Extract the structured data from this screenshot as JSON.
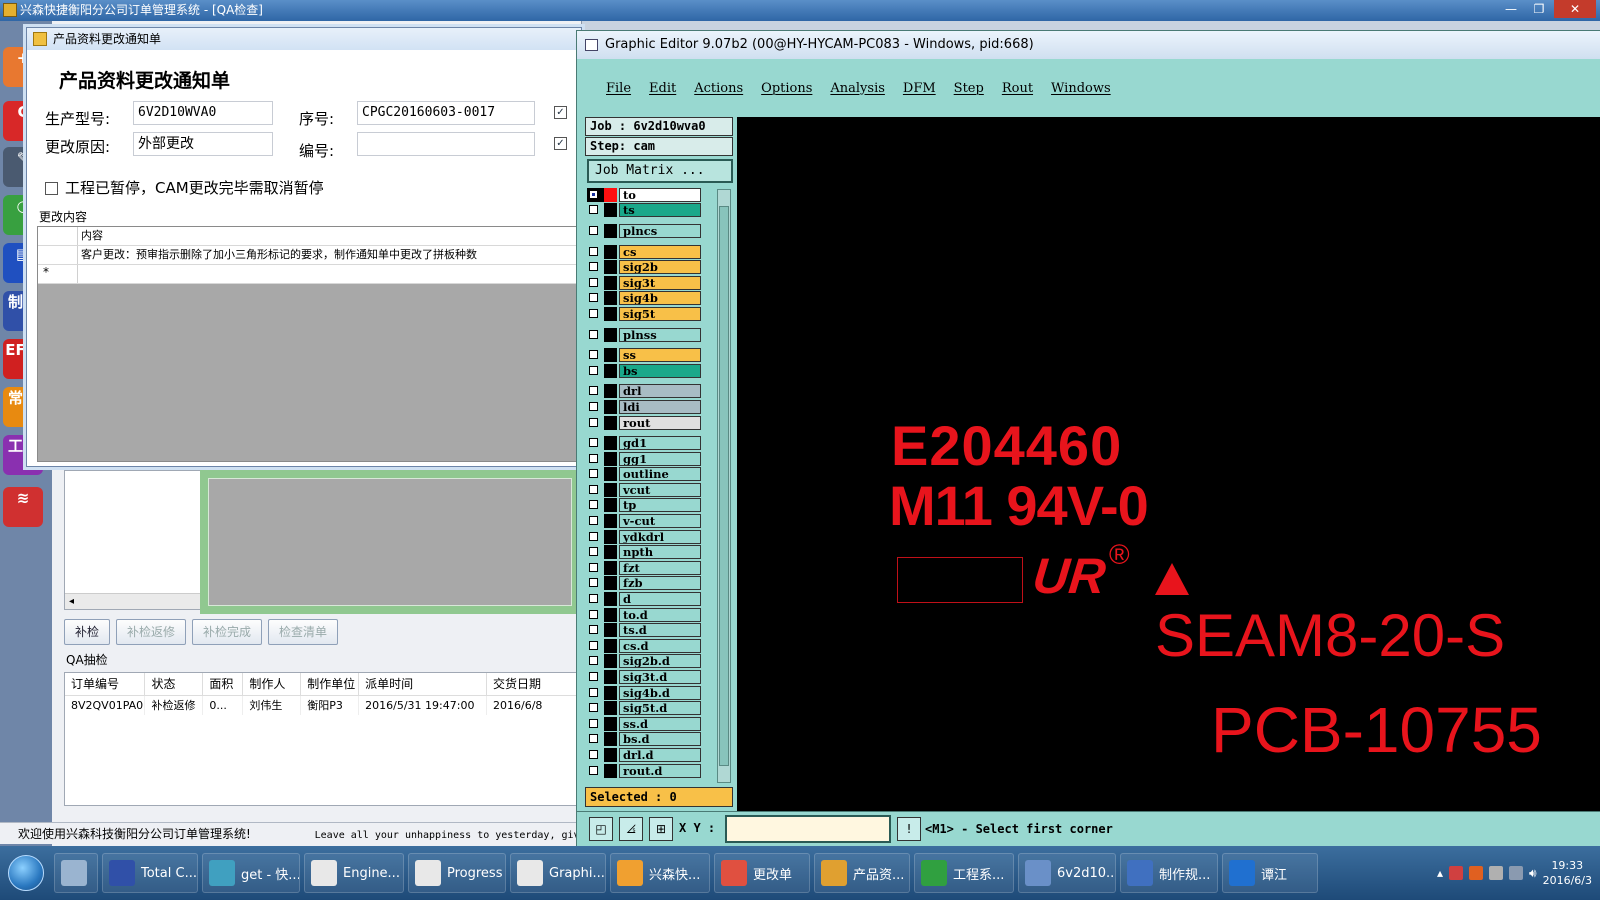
{
  "main_window": {
    "title": "兴森快捷衡阳分公司订单管理系统 - [QA检查]",
    "controls": {
      "minimize": "—",
      "maximize": "❐",
      "close": "✕"
    }
  },
  "launcher": {
    "items": [
      {
        "icon": "orange-plus-icon",
        "label": "+"
      },
      {
        "icon": "red-c-icon",
        "label": "C"
      },
      {
        "icon": "tools-icon",
        "label": "✎"
      },
      {
        "icon": "chart-icon",
        "label": "◔"
      },
      {
        "icon": "doc-icon",
        "label": "▤"
      },
      {
        "icon": "rule-icon",
        "label": "制规"
      },
      {
        "icon": "ef-icon",
        "label": "EF规"
      },
      {
        "icon": "faq-icon",
        "label": "常问"
      },
      {
        "icon": "eng-icon",
        "label": "工能"
      },
      {
        "icon": "db-icon",
        "label": "≋"
      }
    ]
  },
  "dialog": {
    "title": "产品资料更改通知单",
    "heading": "产品资料更改通知单",
    "fields": {
      "model_label": "生产型号:",
      "model_value": "6V2D10WVA0",
      "seq_label": "序号:",
      "seq_value": "CPGC20160603-0017",
      "reason_label": "更改原因:",
      "reason_value": "外部更改",
      "code_label": "编号:",
      "code_value": ""
    },
    "pause_checkbox_label": "工程已暂停，CAM更改完毕需取消暂停",
    "content_section_label": "更改内容",
    "grid": {
      "header": "内容",
      "rows": [
        "客户更改：预审指示删除了加小三角形标记的要求，制作通知单中更改了拼板种数"
      ],
      "new_row_marker": "*"
    }
  },
  "bg_window": {
    "buttons": [
      {
        "label": "补检",
        "enabled": true
      },
      {
        "label": "补检返修",
        "enabled": false
      },
      {
        "label": "补检完成",
        "enabled": false
      },
      {
        "label": "检查清单",
        "enabled": false
      }
    ],
    "qa_section_label": "QA抽检",
    "qa_table": {
      "columns": [
        "订单编号",
        "状态",
        "面积",
        "制作人",
        "制作单位",
        "派单时间",
        "交货日期"
      ],
      "rows": [
        [
          "8V2QV01PA0",
          "补检返修",
          "0...",
          "刘伟生",
          "衡阳P3",
          "2016/5/31 19:47:00",
          "2016/6/8"
        ]
      ]
    },
    "status_welcome": "欢迎使用兴森科技衡阳分公司订单管理系统!",
    "status_scroll": "Leave all your unhappiness to yesterday, giv"
  },
  "graphic_editor": {
    "title": "Graphic Editor 9.07b2 (00@HY-HYCAM-PC083 - Windows, pid:668)",
    "menu": [
      "File",
      "Edit",
      "Actions",
      "Options",
      "Analysis",
      "DFM",
      "Step",
      "Rout",
      "Windows"
    ],
    "job": "Job : 6v2d10wva0",
    "step": "Step: cam",
    "job_matrix": "Job Matrix ...",
    "layers": [
      {
        "name": "to",
        "color": "#ffffff",
        "swatch": "#ff1010",
        "group_end": false,
        "active": true
      },
      {
        "name": "ts",
        "color": "#1aa88a",
        "swatch": "#000000",
        "group_end": true
      },
      {
        "name": "plncs",
        "color": "#98d8d0",
        "swatch": "#000000",
        "group_end": true
      },
      {
        "name": "cs",
        "color": "#f8c048",
        "swatch": "#000000",
        "group_end": false
      },
      {
        "name": "sig2b",
        "color": "#f8c048",
        "swatch": "#000000",
        "group_end": false
      },
      {
        "name": "sig3t",
        "color": "#f8c048",
        "swatch": "#000000",
        "group_end": false
      },
      {
        "name": "sig4b",
        "color": "#f8c048",
        "swatch": "#000000",
        "group_end": false
      },
      {
        "name": "sig5t",
        "color": "#f8c048",
        "swatch": "#000000",
        "group_end": true
      },
      {
        "name": "plnss",
        "color": "#98d8d0",
        "swatch": "#000000",
        "group_end": true
      },
      {
        "name": "ss",
        "color": "#f8c048",
        "swatch": "#000000",
        "group_end": false
      },
      {
        "name": "bs",
        "color": "#1aa88a",
        "swatch": "#000000",
        "group_end": true
      },
      {
        "name": "drl",
        "color": "#a8bcc4",
        "swatch": "#000000",
        "group_end": false
      },
      {
        "name": "ldi",
        "color": "#a8bcc4",
        "swatch": "#000000",
        "group_end": false
      },
      {
        "name": "rout",
        "color": "#e0e0e0",
        "swatch": "#000000",
        "group_end": true
      },
      {
        "name": "gd1",
        "color": "#98d8d0",
        "swatch": "#000000",
        "group_end": false
      },
      {
        "name": "gg1",
        "color": "#98d8d0",
        "swatch": "#000000",
        "group_end": false
      },
      {
        "name": "outline",
        "color": "#98d8d0",
        "swatch": "#000000",
        "group_end": false
      },
      {
        "name": "vcut",
        "color": "#98d8d0",
        "swatch": "#000000",
        "group_end": false
      },
      {
        "name": "tp",
        "color": "#98d8d0",
        "swatch": "#000000",
        "group_end": false
      },
      {
        "name": "v-cut",
        "color": "#98d8d0",
        "swatch": "#000000",
        "group_end": false
      },
      {
        "name": "ydkdrl",
        "color": "#98d8d0",
        "swatch": "#000000",
        "group_end": false
      },
      {
        "name": "npth",
        "color": "#98d8d0",
        "swatch": "#000000",
        "group_end": false
      },
      {
        "name": "fzt",
        "color": "#98d8d0",
        "swatch": "#000000",
        "group_end": false
      },
      {
        "name": "fzb",
        "color": "#98d8d0",
        "swatch": "#000000",
        "group_end": false
      },
      {
        "name": "d",
        "color": "#98d8d0",
        "swatch": "#000000",
        "group_end": false
      },
      {
        "name": "to.d",
        "color": "#98d8d0",
        "swatch": "#000000",
        "group_end": false
      },
      {
        "name": "ts.d",
        "color": "#98d8d0",
        "swatch": "#000000",
        "group_end": false
      },
      {
        "name": "cs.d",
        "color": "#98d8d0",
        "swatch": "#000000",
        "group_end": false
      },
      {
        "name": "sig2b.d",
        "color": "#98d8d0",
        "swatch": "#000000",
        "group_end": false
      },
      {
        "name": "sig3t.d",
        "color": "#98d8d0",
        "swatch": "#000000",
        "group_end": false
      },
      {
        "name": "sig4b.d",
        "color": "#98d8d0",
        "swatch": "#000000",
        "group_end": false
      },
      {
        "name": "sig5t.d",
        "color": "#98d8d0",
        "swatch": "#000000",
        "group_end": false
      },
      {
        "name": "ss.d",
        "color": "#98d8d0",
        "swatch": "#000000",
        "group_end": false
      },
      {
        "name": "bs.d",
        "color": "#98d8d0",
        "swatch": "#000000",
        "group_end": false
      },
      {
        "name": "drl.d",
        "color": "#98d8d0",
        "swatch": "#000000",
        "group_end": false
      },
      {
        "name": "rout.d",
        "color": "#98d8d0",
        "swatch": "#000000",
        "group_end": false
      }
    ],
    "selected": "Selected : 0",
    "xy_label": "X Y :",
    "xy_value": "",
    "prompt": "<M1> - Select first corner",
    "canvas": {
      "line1": "E204460",
      "line2": "M11 94V-0",
      "ul_mark": "UR",
      "registered": "®",
      "line3": "SEAM8-20-S",
      "line4": "PCB-10755",
      "ink_color": "#e8141c"
    }
  },
  "taskbar": {
    "items": [
      {
        "label": "",
        "icon": "calculator-icon",
        "color": "#9ab4d0"
      },
      {
        "label": "Total C...",
        "icon": "floppy-icon",
        "color": "#3050a8"
      },
      {
        "label": "get - 快...",
        "icon": "eye-icon",
        "color": "#40a0c0"
      },
      {
        "label": "Engine...",
        "icon": "x-window-icon",
        "color": "#e8e8e8"
      },
      {
        "label": "Progress",
        "icon": "x-window-icon",
        "color": "#e8e8e8"
      },
      {
        "label": "Graphi...",
        "icon": "x-window-icon",
        "color": "#e8e8e8"
      },
      {
        "label": "兴森快...",
        "icon": "app-icon",
        "color": "#f0a030"
      },
      {
        "label": "更改单",
        "icon": "form-icon",
        "color": "#e05040"
      },
      {
        "label": "产品资...",
        "icon": "form-icon",
        "color": "#e0a030"
      },
      {
        "label": "工程系...",
        "icon": "f-icon",
        "color": "#30a040"
      },
      {
        "label": "6v2d10...",
        "icon": "image-icon",
        "color": "#6a90c8"
      },
      {
        "label": "制作规...",
        "icon": "doc-icon",
        "color": "#4070c0"
      },
      {
        "label": "谭江",
        "icon": "chat-icon",
        "color": "#2070d0"
      }
    ],
    "clock_time": "19:33",
    "clock_date": "2016/6/3"
  }
}
